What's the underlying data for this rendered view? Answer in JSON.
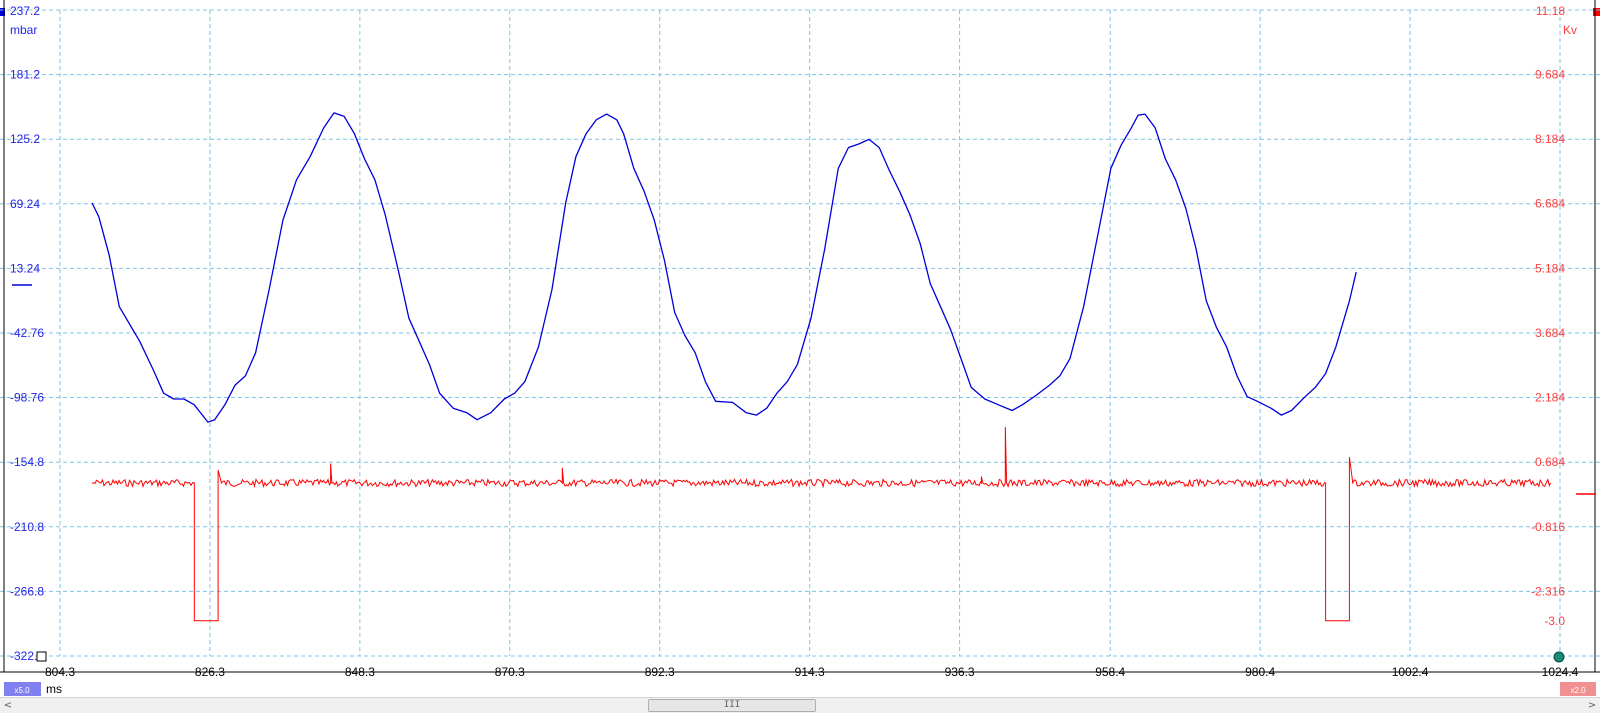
{
  "chart_data": {
    "type": "line",
    "x": {
      "unit": "ms",
      "range": [
        804.3,
        1024.4
      ],
      "ticks": [
        "804.3",
        "826.3",
        "848.3",
        "870.3",
        "892.3",
        "914.3",
        "936.3",
        "958.4",
        "980.4",
        "1002.4",
        "1024.4"
      ]
    },
    "y_left": {
      "unit": "mbar",
      "range": [
        -322.8,
        237.2
      ],
      "ticks": [
        "237.2",
        "181.2",
        "125.2",
        "69.24",
        "13.24",
        "-42.76",
        "-98.76",
        "-154.8",
        "-210.8",
        "-266.8",
        "-322.8"
      ]
    },
    "y_right": {
      "unit": "Kv",
      "range": [
        -3.816,
        11.18
      ],
      "ticks": [
        "11.18",
        "9.684",
        "8.184",
        "6.684",
        "5.184",
        "3.684",
        "2.184",
        "0.684",
        "-0.816",
        "-2.316"
      ],
      "extra_label": "-3.0"
    },
    "grid": true,
    "series": [
      {
        "axis": "left",
        "color": "#0000dd",
        "points": [
          [
            809.0,
            70
          ],
          [
            810.0,
            58
          ],
          [
            811.5,
            25
          ],
          [
            813.0,
            -20
          ],
          [
            814.5,
            -35
          ],
          [
            816.0,
            -50
          ],
          [
            818.0,
            -75
          ],
          [
            819.5,
            -95
          ],
          [
            821.0,
            -100
          ],
          [
            822.5,
            -100
          ],
          [
            824.0,
            -105
          ],
          [
            826.0,
            -120
          ],
          [
            827.0,
            -118
          ],
          [
            828.5,
            -105
          ],
          [
            830.0,
            -88
          ],
          [
            831.5,
            -80
          ],
          [
            833.0,
            -60
          ],
          [
            835.0,
            -5
          ],
          [
            837.0,
            55
          ],
          [
            839.0,
            90
          ],
          [
            841.0,
            110
          ],
          [
            843.0,
            135
          ],
          [
            844.5,
            148
          ],
          [
            846.0,
            145
          ],
          [
            847.5,
            130
          ],
          [
            849.0,
            108
          ],
          [
            850.5,
            90
          ],
          [
            852.0,
            60
          ],
          [
            854.0,
            10
          ],
          [
            855.5,
            -30
          ],
          [
            857.0,
            -50
          ],
          [
            858.5,
            -70
          ],
          [
            860.0,
            -95
          ],
          [
            862.0,
            -108
          ],
          [
            864.0,
            -112
          ],
          [
            865.5,
            -118
          ],
          [
            867.5,
            -112
          ],
          [
            869.5,
            -100
          ],
          [
            871.0,
            -95
          ],
          [
            872.5,
            -85
          ],
          [
            874.5,
            -55
          ],
          [
            876.5,
            -5
          ],
          [
            878.5,
            70
          ],
          [
            880.0,
            110
          ],
          [
            881.5,
            130
          ],
          [
            883.0,
            142
          ],
          [
            884.5,
            147
          ],
          [
            886.0,
            142
          ],
          [
            887.0,
            130
          ],
          [
            888.5,
            100
          ],
          [
            890.0,
            80
          ],
          [
            891.5,
            55
          ],
          [
            893.0,
            20
          ],
          [
            894.5,
            -25
          ],
          [
            896.0,
            -45
          ],
          [
            897.5,
            -60
          ],
          [
            899.0,
            -85
          ],
          [
            900.5,
            -102
          ],
          [
            903.0,
            -103
          ],
          [
            905.0,
            -112
          ],
          [
            906.5,
            -114
          ],
          [
            908.0,
            -108
          ],
          [
            909.5,
            -95
          ],
          [
            911.0,
            -85
          ],
          [
            912.5,
            -70
          ],
          [
            914.5,
            -30
          ],
          [
            916.5,
            30
          ],
          [
            918.5,
            100
          ],
          [
            920.0,
            118
          ],
          [
            921.5,
            121
          ],
          [
            923.0,
            125
          ],
          [
            924.5,
            118
          ],
          [
            926.0,
            98
          ],
          [
            927.5,
            80
          ],
          [
            929.0,
            60
          ],
          [
            930.5,
            35
          ],
          [
            932.0,
            0
          ],
          [
            933.5,
            -20
          ],
          [
            935.0,
            -40
          ],
          [
            936.5,
            -65
          ],
          [
            938.0,
            -90
          ],
          [
            940.0,
            -100
          ],
          [
            942.0,
            -105
          ],
          [
            944.0,
            -110
          ],
          [
            945.5,
            -105
          ],
          [
            947.5,
            -97
          ],
          [
            949.5,
            -88
          ],
          [
            951.0,
            -80
          ],
          [
            952.5,
            -65
          ],
          [
            954.5,
            -20
          ],
          [
            956.5,
            40
          ],
          [
            958.5,
            100
          ],
          [
            960.0,
            120
          ],
          [
            961.5,
            135
          ],
          [
            962.5,
            146
          ],
          [
            963.5,
            147
          ],
          [
            965.0,
            135
          ],
          [
            966.5,
            108
          ],
          [
            968.0,
            90
          ],
          [
            969.5,
            65
          ],
          [
            971.0,
            30
          ],
          [
            972.5,
            -15
          ],
          [
            974.0,
            -38
          ],
          [
            975.5,
            -55
          ],
          [
            977.0,
            -80
          ],
          [
            978.5,
            -98
          ],
          [
            980.0,
            -102
          ],
          [
            982.0,
            -108
          ],
          [
            983.5,
            -114
          ],
          [
            985.0,
            -110
          ],
          [
            987.0,
            -98
          ],
          [
            988.5,
            -90
          ],
          [
            990.0,
            -78
          ],
          [
            991.5,
            -55
          ],
          [
            993.5,
            -15
          ],
          [
            994.5,
            10
          ]
        ]
      },
      {
        "axis": "right",
        "color": "#ff0000",
        "baseline": 0.2,
        "points": [
          [
            809.0,
            0.2
          ],
          [
            824.0,
            0.2
          ],
          [
            824.0,
            -3.0
          ],
          [
            827.5,
            -3.0
          ],
          [
            827.5,
            0.5
          ],
          [
            828.0,
            0.2
          ],
          [
            844.0,
            0.2
          ],
          [
            844.0,
            0.65
          ],
          [
            844.2,
            0.2
          ],
          [
            878.0,
            0.2
          ],
          [
            878.0,
            0.55
          ],
          [
            878.2,
            0.2
          ],
          [
            939.5,
            0.2
          ],
          [
            939.5,
            0.35
          ],
          [
            939.7,
            0.2
          ],
          [
            943.0,
            0.2
          ],
          [
            943.0,
            1.5
          ],
          [
            943.2,
            0.2
          ],
          [
            990.0,
            0.2
          ],
          [
            990.0,
            -3.0
          ],
          [
            993.5,
            -3.0
          ],
          [
            993.5,
            0.8
          ],
          [
            994.0,
            0.2
          ],
          [
            1023.0,
            0.2
          ]
        ]
      }
    ]
  },
  "footer": {
    "x_unit": "ms",
    "left_zoom": "x5.0",
    "right_zoom": "x2.0"
  },
  "colors": {
    "left_axis": "#2424e6",
    "right_axis": "#ff4040",
    "grid": "#7fc4e6"
  },
  "icons": {
    "scroll_left": "chevron-left-icon",
    "scroll_right": "chevron-right-icon",
    "scroll_thumb": "grip-icon"
  }
}
